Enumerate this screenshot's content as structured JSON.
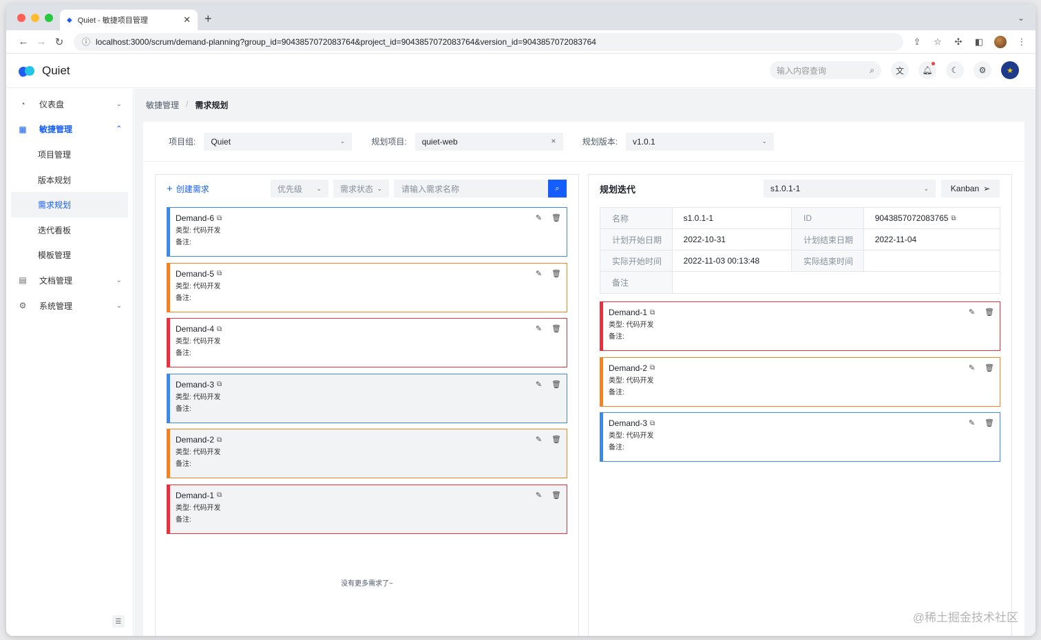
{
  "browser": {
    "tab_title": "Quiet - 敏捷项目管理",
    "url": "localhost:3000/scrum/demand-planning?group_id=9043857072083764&project_id=9043857072083764&version_id=9043857072083764"
  },
  "header": {
    "app_name": "Quiet",
    "search_placeholder": "输入内容查询"
  },
  "sidebar": {
    "items": [
      {
        "label": "仪表盘"
      },
      {
        "label": "敏捷管理"
      },
      {
        "label": "项目管理"
      },
      {
        "label": "版本规划"
      },
      {
        "label": "需求规划"
      },
      {
        "label": "迭代看板"
      },
      {
        "label": "模板管理"
      },
      {
        "label": "文档管理"
      },
      {
        "label": "系统管理"
      }
    ]
  },
  "breadcrumb": {
    "parent": "敏捷管理",
    "sep": "/",
    "current": "需求规划"
  },
  "filters": {
    "group_label": "项目组:",
    "group_value": "Quiet",
    "project_label": "规划项目:",
    "project_value": "quiet-web",
    "version_label": "规划版本:",
    "version_value": "v1.0.1"
  },
  "left": {
    "create_label": "创建需求",
    "priority_placeholder": "优先级",
    "status_placeholder": "需求状态",
    "search_placeholder": "请输入需求名称",
    "cards": [
      {
        "title": "Demand-6",
        "type_line": "类型: 代码开发",
        "remark_line": "备注:",
        "color": "#3c8ae8"
      },
      {
        "title": "Demand-5",
        "type_line": "类型: 代码开发",
        "remark_line": "备注:",
        "color": "#f5821f"
      },
      {
        "title": "Demand-4",
        "type_line": "类型: 代码开发",
        "remark_line": "备注:",
        "color": "#e8313c"
      },
      {
        "title": "Demand-3",
        "type_line": "类型: 代码开发",
        "remark_line": "备注:",
        "color": "#3c8ae8"
      },
      {
        "title": "Demand-2",
        "type_line": "类型: 代码开发",
        "remark_line": "备注:",
        "color": "#f5821f"
      },
      {
        "title": "Demand-1",
        "type_line": "类型: 代码开发",
        "remark_line": "备注:",
        "color": "#e8313c"
      }
    ],
    "no_more": "没有更多需求了~"
  },
  "right": {
    "title": "规划迭代",
    "iteration": "s1.0.1-1",
    "kanban_label": "Kanban",
    "details": {
      "name_key": "名称",
      "name_val": "s1.0.1-1",
      "id_key": "ID",
      "id_val": "9043857072083765",
      "plan_start_key": "计划开始日期",
      "plan_start_val": "2022-10-31",
      "plan_end_key": "计划结束日期",
      "plan_end_val": "2022-11-04",
      "actual_start_key": "实际开始时间",
      "actual_start_val": "2022-11-03 00:13:48",
      "actual_end_key": "实际结束时间",
      "actual_end_val": "",
      "remark_key": "备注",
      "remark_val": ""
    },
    "cards": [
      {
        "title": "Demand-1",
        "type_line": "类型: 代码开发",
        "remark_line": "备注:",
        "color": "#e8313c"
      },
      {
        "title": "Demand-2",
        "type_line": "类型: 代码开发",
        "remark_line": "备注:",
        "color": "#f5821f"
      },
      {
        "title": "Demand-3",
        "type_line": "类型: 代码开发",
        "remark_line": "备注:",
        "color": "#3c8ae8"
      }
    ]
  },
  "watermark": "@稀土掘金技术社区"
}
